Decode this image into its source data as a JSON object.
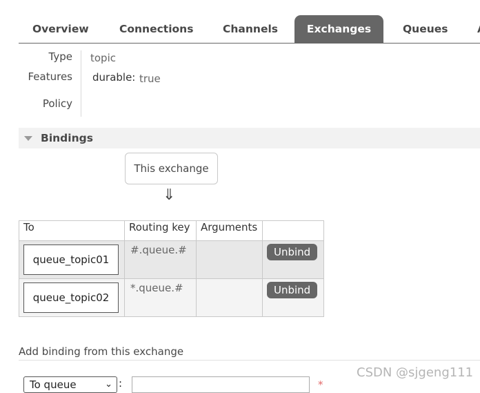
{
  "tabs": {
    "overview": "Overview",
    "connections": "Connections",
    "channels": "Channels",
    "exchanges": "Exchanges",
    "queues": "Queues",
    "cut": "A"
  },
  "details": {
    "type_label": "Type",
    "type_value": "topic",
    "features_label": "Features",
    "features_key": "durable:",
    "features_value": "true",
    "policy_label": "Policy"
  },
  "bindings": {
    "title": "Bindings",
    "this_exchange": "This exchange",
    "arrow": "⇓",
    "columns": [
      "To",
      "Routing key",
      "Arguments",
      ""
    ],
    "rows": [
      {
        "to": "queue_topic01",
        "routing_key": "#.queue.#",
        "arguments": "",
        "action": "Unbind"
      },
      {
        "to": "queue_topic02",
        "routing_key": "*.queue.#",
        "arguments": "",
        "action": "Unbind"
      }
    ]
  },
  "add_binding": {
    "title": "Add binding from this exchange",
    "destination_type": "To queue",
    "colon": ":",
    "destination_value": "",
    "required_mark": "*"
  },
  "watermark": "CSDN @sjgeng111",
  "colors": {
    "tab_active_bg": "#666666",
    "button_bg": "#666666",
    "required": "#e36b6b"
  }
}
